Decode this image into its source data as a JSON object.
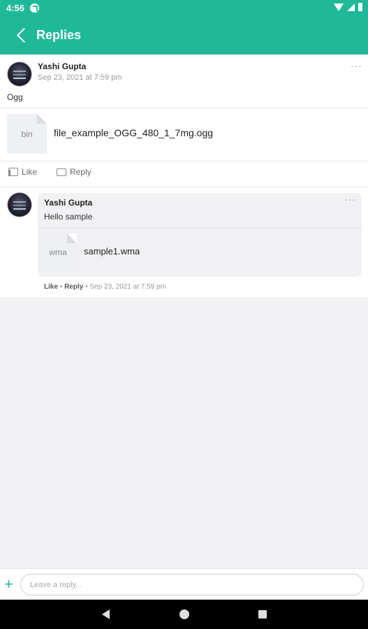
{
  "status_bar": {
    "time": "4:56"
  },
  "app_bar": {
    "title": "Replies"
  },
  "post": {
    "author": "Yashi Gupta",
    "date": "Sep 23, 2021 at 7:59 pm",
    "more": "···",
    "text": "Ogg",
    "attachment": {
      "ext": "bin",
      "filename": "file_example_OGG_480_1_7mg.ogg"
    },
    "actions": {
      "like": "Like",
      "reply": "Reply"
    }
  },
  "reply": {
    "author": "Yashi Gupta",
    "more": "···",
    "text": "Hello sample",
    "attachment": {
      "ext": "wma",
      "filename": "sample1.wma"
    },
    "meta": {
      "like": "Like",
      "sep1": " • ",
      "reply": "Reply",
      "sep2": " • ",
      "date": "Sep 23, 2021 at 7:59 pm"
    }
  },
  "composer": {
    "plus": "+",
    "placeholder": "Leave a reply..."
  },
  "colors": {
    "accent": "#1fb99a"
  }
}
